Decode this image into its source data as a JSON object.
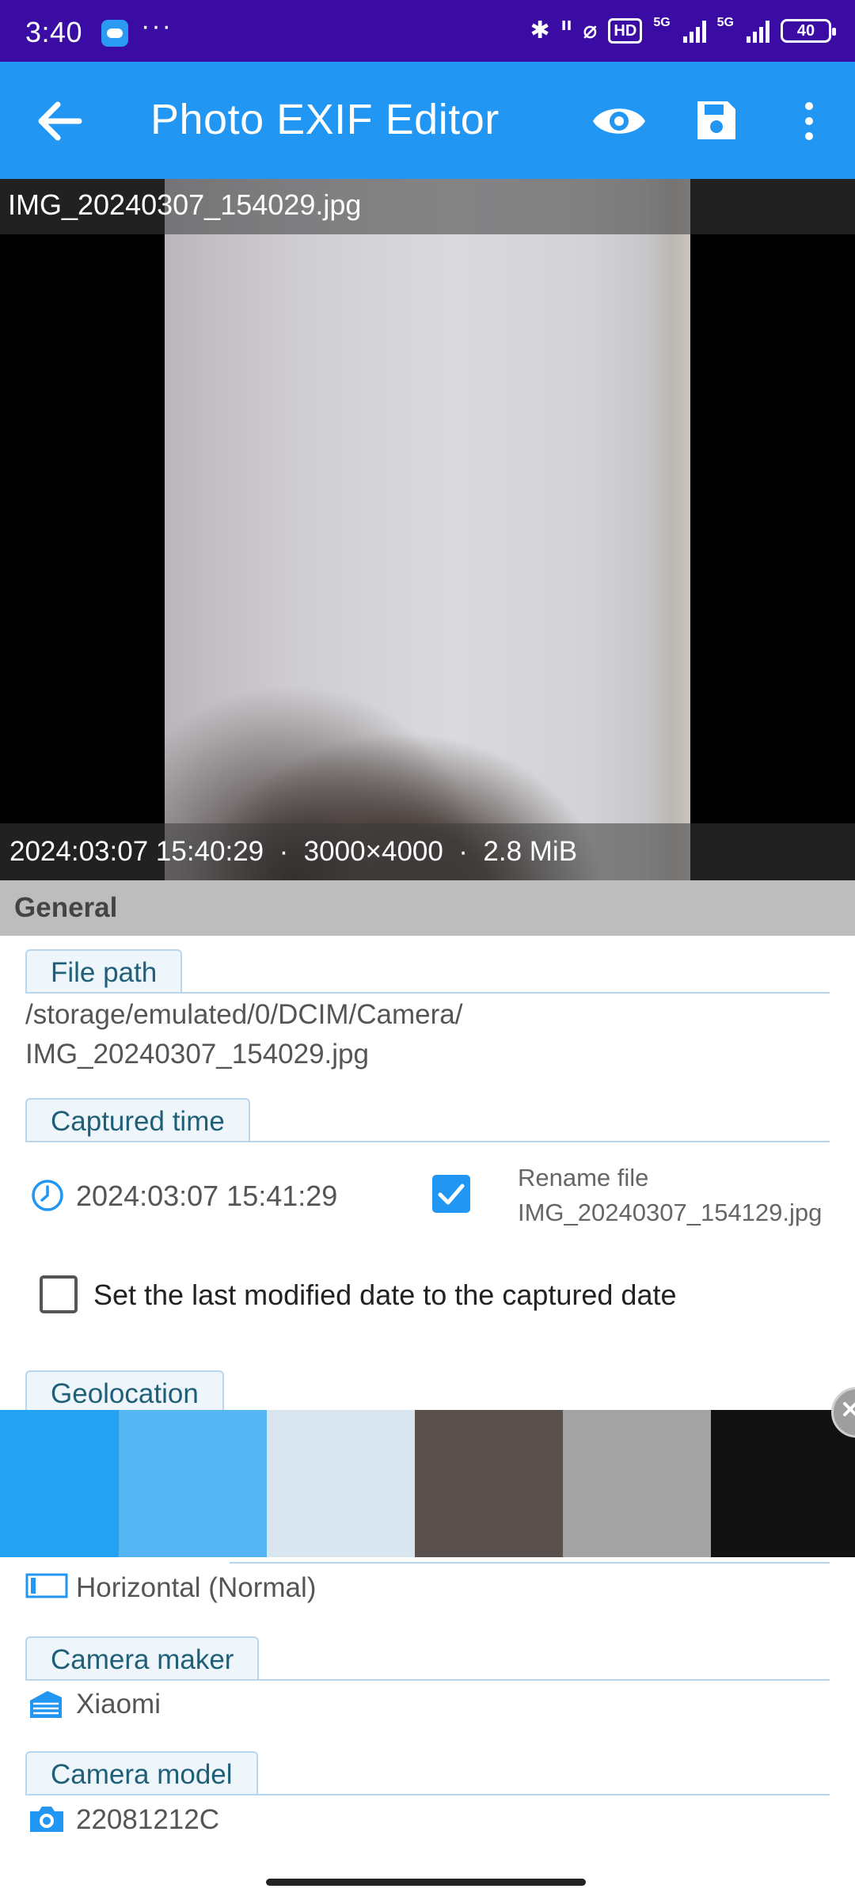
{
  "status_bar": {
    "time": "3:40",
    "dots": "···",
    "hd_badge": "HD",
    "net1": "5G",
    "net2": "5G",
    "battery": "40"
  },
  "app_bar": {
    "title": "Photo EXIF Editor"
  },
  "photo": {
    "filename": "IMG_20240307_154029.jpg",
    "info": "2024:03:07 15:40:29  ·  3000×4000  ·  2.8 MiB"
  },
  "section": {
    "title": "General"
  },
  "fields": {
    "file_path": {
      "label": "File path",
      "line1": "/storage/emulated/0/DCIM/Camera/",
      "line2": "IMG_20240307_154029.jpg"
    },
    "captured_time": {
      "label": "Captured time",
      "value": "2024:03:07 15:41:29",
      "rename_label": "Rename file",
      "rename_value": "IMG_20240307_154129.jpg",
      "rename_checked": true
    },
    "modified_date": {
      "label": "Set the last modified date to the captured date",
      "checked": false
    },
    "geolocation": {
      "label": "Geolocation"
    },
    "orientation": {
      "value": "Horizontal (Normal)"
    },
    "camera_maker": {
      "label": "Camera maker",
      "value": "Xiaomi"
    },
    "camera_model": {
      "label": "Camera model",
      "value": "22081212C"
    }
  },
  "palette": {
    "colors": [
      "#23a1f2",
      "#56b5f3",
      "#d9e6ef",
      "#5a514f",
      "#a4a3a3",
      "#111111"
    ]
  },
  "colors": {
    "status_bar": "#3a0ca3",
    "app_bar": "#2196f3",
    "accent": "#2196f3"
  }
}
